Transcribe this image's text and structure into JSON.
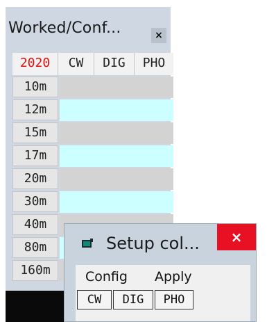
{
  "main_window": {
    "title": "Worked/Conf...",
    "close_label": "×",
    "header": {
      "year": "2020",
      "columns": [
        "CW",
        "DIG",
        "PHO"
      ]
    },
    "bands": [
      "10m",
      "12m",
      "15m",
      "17m",
      "20m",
      "30m",
      "40m",
      "80m",
      "160m"
    ]
  },
  "setup_window": {
    "title": "Setup col...",
    "close_label": "×",
    "menu": {
      "config": "Config",
      "apply": "Apply"
    },
    "modes": [
      "CW",
      "DIG",
      "PHO"
    ]
  },
  "colors": {
    "grey_cell": "#d3d3d3",
    "cyan_cell": "#ccffff",
    "year": "#e01010",
    "close_red": "#e81123"
  }
}
